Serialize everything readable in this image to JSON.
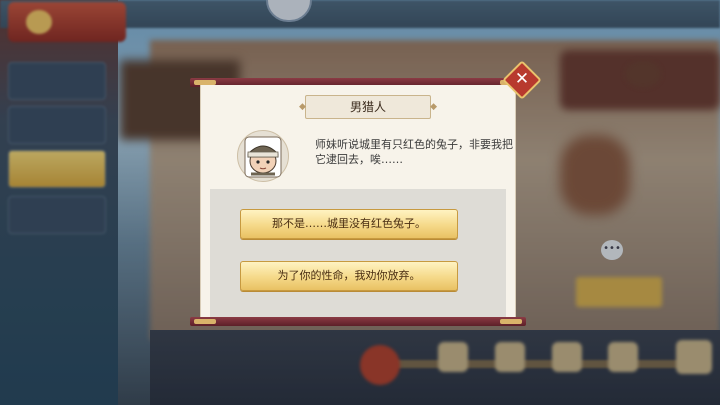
{
  "header": {
    "badge_text": "",
    "compass_icon": "compass-icon"
  },
  "sidebar": {
    "items": [
      {
        "label": ""
      },
      {
        "label": ""
      },
      {
        "label": "",
        "active": true
      },
      {
        "label": ""
      }
    ]
  },
  "dialog": {
    "speaker_name": "男猎人",
    "speech": "师妹听说城里有只红色的兔子，非要我把它逮回去，唉……",
    "choices": [
      {
        "label": "那不是……城里没有红色兔子。"
      },
      {
        "label": "为了你的性命，我劝你放弃。"
      }
    ],
    "close_icon": "close-icon",
    "close_symbol": "✕",
    "portrait_icon": "hunter-portrait"
  },
  "background": {
    "chat_symbol": "•••",
    "start_button": ""
  },
  "colors": {
    "accent_gold": "#f5d989",
    "frame_red": "#8b3b44",
    "close_red": "#b83a2e",
    "panel_bg": "#f7f3ea"
  }
}
